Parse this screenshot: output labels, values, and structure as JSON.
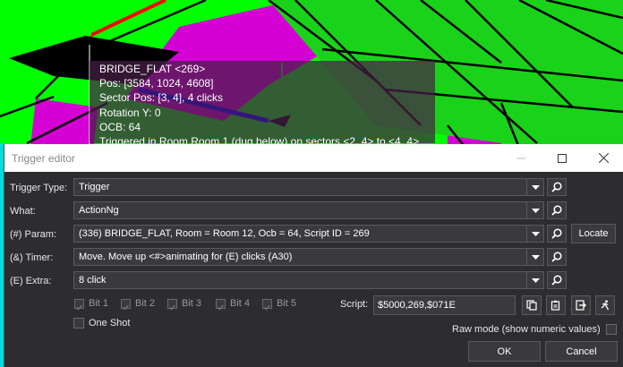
{
  "viewport": {
    "info_lines": [
      "BRIDGE_FLAT <269>",
      "Pos: [3584, 1024, 4608]",
      "Sector Pos: [3, 4], 4 clicks",
      "Rotation Y: 0",
      "OCB: 64",
      "Triggered in Room Room 1 (dug below) on sectors <2, 4> to <4, 4>"
    ]
  },
  "dialog": {
    "title": "Trigger editor",
    "rows": [
      {
        "label": "Trigger Type:",
        "value": "Trigger"
      },
      {
        "label": "What:",
        "value": "ActionNg"
      },
      {
        "label": "(#) Param:",
        "value": "(336) BRIDGE_FLAT, Room = Room 12, Ocb = 64, Script ID = 269"
      },
      {
        "label": "(&) Timer:",
        "value": "Move. Move up <#>animating for (E) clicks (A30)"
      },
      {
        "label": "(E) Extra:",
        "value": "8 click"
      }
    ],
    "locate_label": "Locate",
    "bits": [
      "Bit 1",
      "Bit 2",
      "Bit 3",
      "Bit 4",
      "Bit 5"
    ],
    "script_label": "Script:",
    "script_value": "$5000,269,$071E",
    "one_shot_label": "One Shot",
    "raw_mode_label": "Raw mode (show numeric values)",
    "ok_label": "OK",
    "cancel_label": "Cancel"
  }
}
